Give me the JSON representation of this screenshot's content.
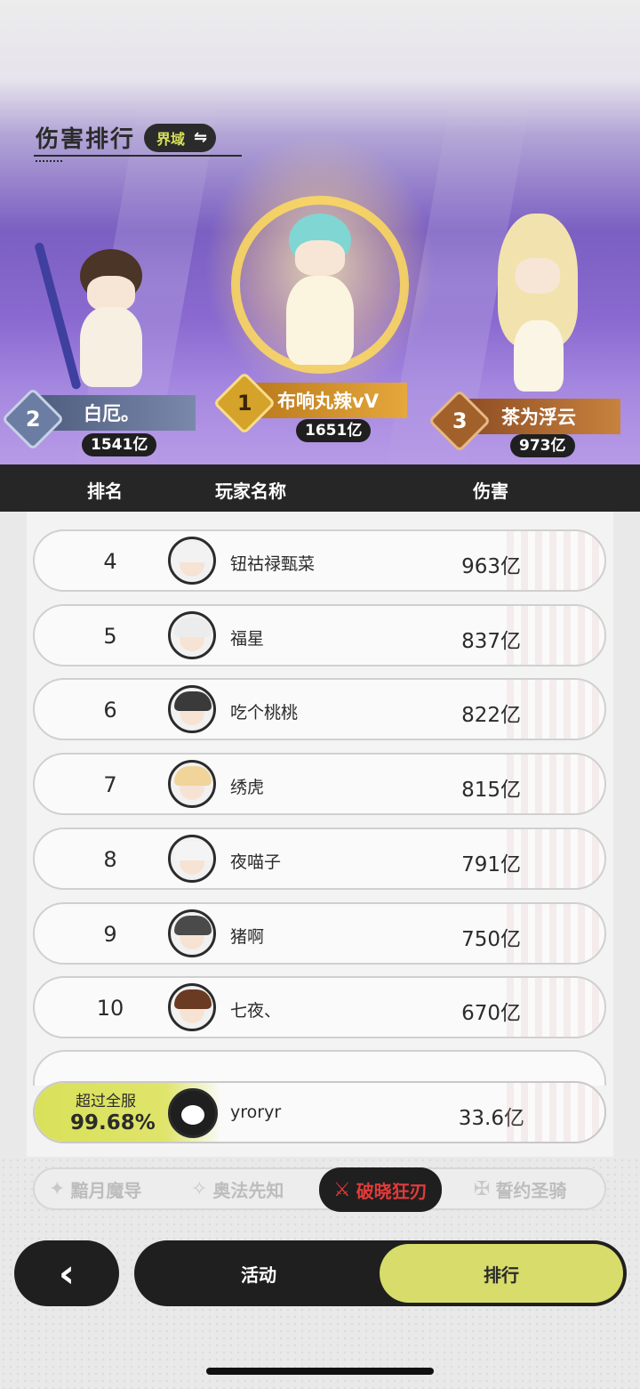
{
  "header": {
    "title": "伤害排行",
    "toggle_label": "界域",
    "toggle_icon": "⇋"
  },
  "podium": [
    {
      "rank": "2",
      "name": "白厄。",
      "score": "1541亿",
      "plate_color": "#5f6c8c"
    },
    {
      "rank": "1",
      "name": "布响丸辣vV",
      "score": "1651亿",
      "plate_color": "#c98a24"
    },
    {
      "rank": "3",
      "name": "茶为浮云",
      "score": "973亿",
      "plate_color": "#9b5a2c"
    }
  ],
  "table": {
    "col_rank": "排名",
    "col_name": "玩家名称",
    "col_damage": "伤害"
  },
  "rows": [
    {
      "rank": "4",
      "name": "钮祜禄甄菜",
      "damage": "963亿",
      "hair": "#f2f2f2"
    },
    {
      "rank": "5",
      "name": "福星",
      "damage": "837亿",
      "hair": "#ececec"
    },
    {
      "rank": "6",
      "name": "吃个桃桃",
      "damage": "822亿",
      "hair": "#3a3a3a"
    },
    {
      "rank": "7",
      "name": "绣虎",
      "damage": "815亿",
      "hair": "#f0d49a"
    },
    {
      "rank": "8",
      "name": "夜喵子",
      "damage": "791亿",
      "hair": "#f4f4f4"
    },
    {
      "rank": "9",
      "name": "猪啊",
      "damage": "750亿",
      "hair": "#4a4a4a"
    },
    {
      "rank": "10",
      "name": "七夜、",
      "damage": "670亿",
      "hair": "#6b3a22"
    }
  ],
  "self": {
    "exceed_label": "超过全服",
    "percent": "99.68%",
    "name": "yroryr",
    "damage": "33.6亿"
  },
  "class_tabs": [
    {
      "label": "黯月魔导",
      "icon": "✦"
    },
    {
      "label": "奥法先知",
      "icon": "✧"
    },
    {
      "label": "破晓狂刃",
      "icon": "⚔"
    },
    {
      "label": "誓约圣骑",
      "icon": "✠"
    }
  ],
  "nav": {
    "back_icon": "‹",
    "activity": "活动",
    "ranking": "排行"
  }
}
